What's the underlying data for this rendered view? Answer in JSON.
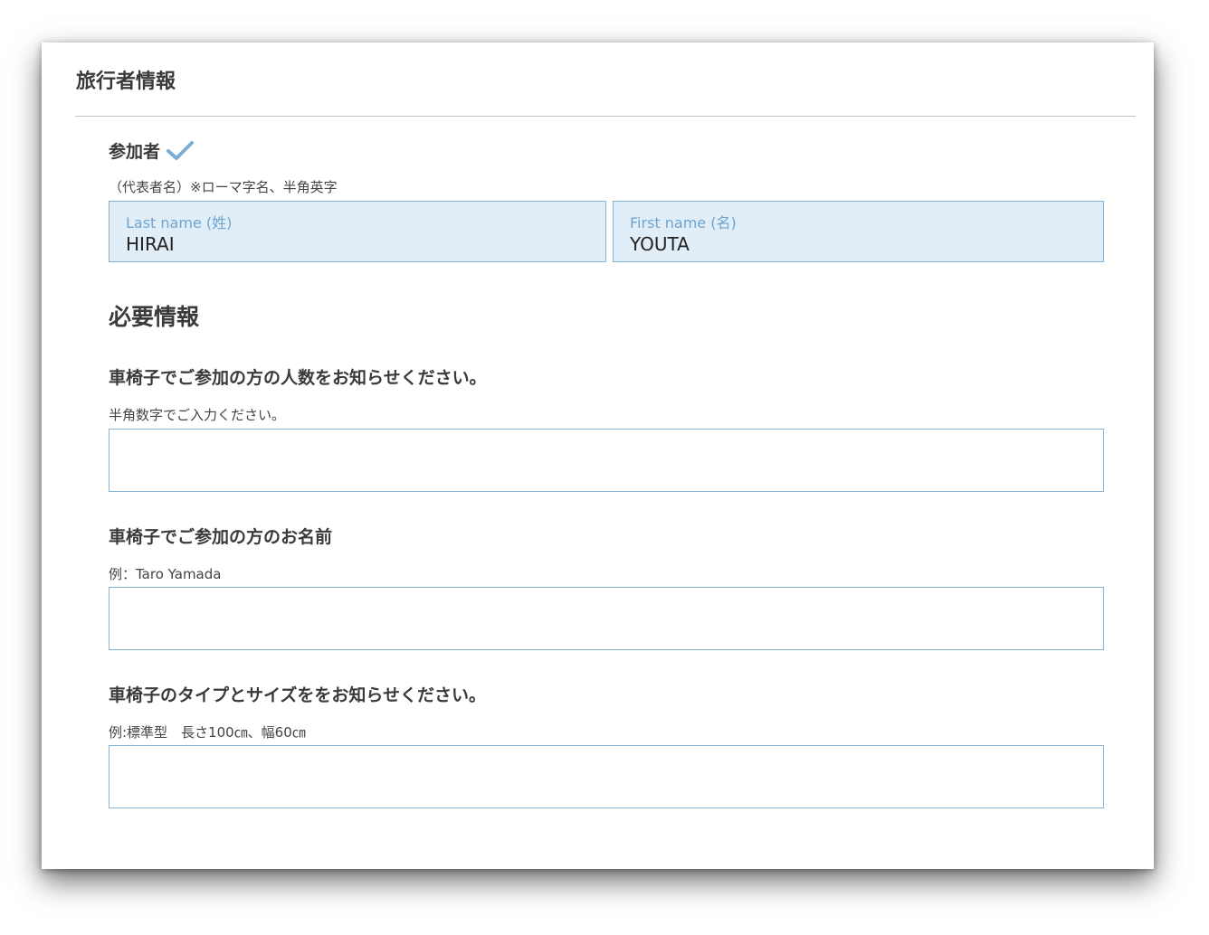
{
  "section": {
    "title": "旅行者情報"
  },
  "participant": {
    "title": "参加者",
    "note": "（代表者名）※ローマ字名、半角英字",
    "last_name": {
      "label": "Last name (姓)",
      "value": "HIRAI"
    },
    "first_name": {
      "label": "First name (名)",
      "value": "YOUTA"
    }
  },
  "required": {
    "title": "必要情報",
    "questions": [
      {
        "title": "車椅子でご参加の方の人数をお知らせください。",
        "note": "半角数字でご入力ください。",
        "value": ""
      },
      {
        "title": "車椅子でご参加の方のお名前",
        "note": "例：Taro Yamada",
        "value": ""
      },
      {
        "title": "車椅子のタイプとサイズををお知らせください。",
        "note": "例:標準型　長さ100㎝、幅60㎝",
        "value": ""
      }
    ]
  },
  "colors": {
    "accent": "#86b2d4",
    "label": "#6fa4cf",
    "filled_bg": "#e2eef7",
    "check": "#7aaed6"
  },
  "icons": {
    "check": "check-icon"
  }
}
